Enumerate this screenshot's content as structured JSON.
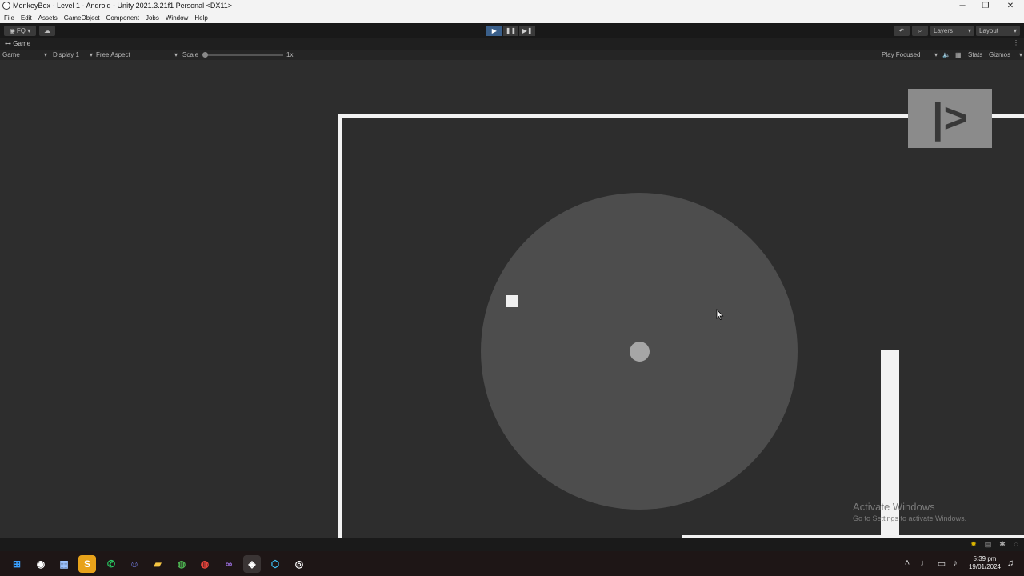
{
  "window": {
    "title": "MonkeyBox - Level 1 - Android - Unity 2021.3.21f1 Personal <DX11>",
    "controls": {
      "minimize": "─",
      "restore": "❐",
      "close": "✕"
    }
  },
  "menu": [
    "File",
    "Edit",
    "Assets",
    "GameObject",
    "Component",
    "Jobs",
    "Window",
    "Help"
  ],
  "toolbar": {
    "account": "FQ",
    "play": "▶",
    "pause": "❚❚",
    "step": "▶❚",
    "layers": "Layers",
    "layout": "Layout",
    "history_icon": "↶",
    "search_icon": "⌕"
  },
  "tab": {
    "label": "Game"
  },
  "gamebar": {
    "mode": "Game",
    "display": "Display 1",
    "aspect": "Free Aspect",
    "scale_label": "Scale",
    "scale_value": "1x",
    "play_mode": "Play Focused",
    "stats": "Stats",
    "gizmos": "Gizmos"
  },
  "game": {
    "next_button": "|>",
    "watermark_title": "Activate Windows",
    "watermark_sub": "Go to Settings to activate Windows."
  },
  "taskbar": {
    "clock_time": "5:39 pm",
    "clock_date": "19/01/2024"
  },
  "colors": {
    "unity_dark": "#282828",
    "play_active": "#3a5f8a",
    "wall": "#f2f2f2",
    "circle": "#4d4d4d"
  }
}
